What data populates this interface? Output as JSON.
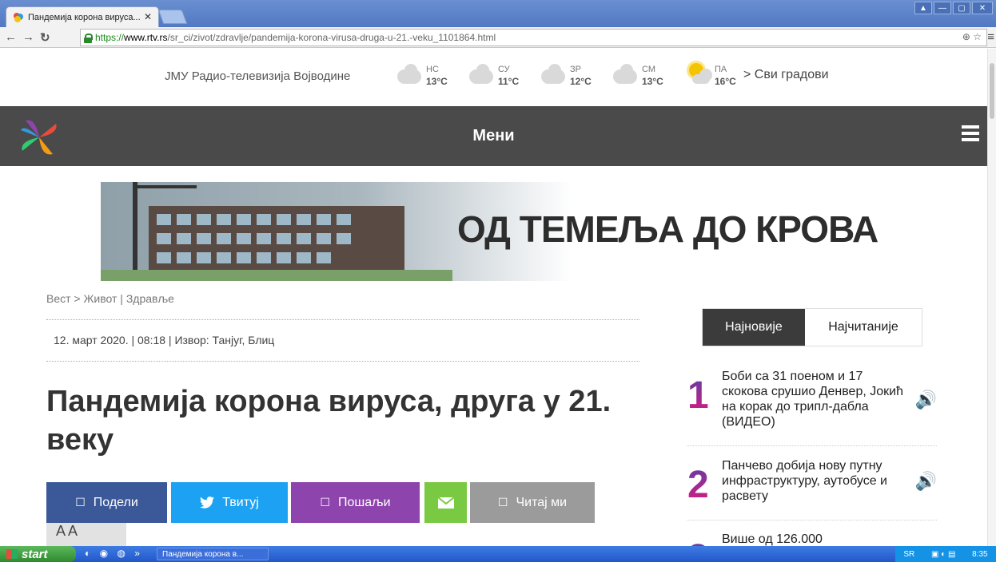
{
  "browser": {
    "tab_title": "Пандемија корона вируса...",
    "url_scheme": "https://",
    "url_host": "www.rtv.rs",
    "url_path": "/sr_ci/zivot/zdravlje/pandemija-korona-virusa-druga-u-21.-veku_1101864.html",
    "close_glyph": "✕"
  },
  "header": {
    "site_name": "ЈМУ Радио-телевизија Војводине",
    "weather": [
      {
        "city": "НС",
        "temp": "13°C",
        "icon": "cloud-icon"
      },
      {
        "city": "СУ",
        "temp": "11°C",
        "icon": "cloud-icon"
      },
      {
        "city": "ЗР",
        "temp": "12°C",
        "icon": "cloud-icon"
      },
      {
        "city": "СМ",
        "temp": "13°C",
        "icon": "cloud-icon"
      },
      {
        "city": "ПА",
        "temp": "16°C",
        "icon": "sun-cloud-icon"
      }
    ],
    "all_cities": "> Сви градови"
  },
  "menu": {
    "label": "Мени"
  },
  "banner": {
    "text": "ОД ТЕМЕЉА ДО КРОВА"
  },
  "article": {
    "breadcrumb": "Вест > Живот | Здравље",
    "meta": "12. март 2020. | 08:18 | Извор: Танјуг, Блиц",
    "title": "Пандемија корона вируса, друга у 21. веку",
    "share": {
      "podeli": "Подели",
      "tvituj": "Твитуј",
      "posalji": "Пошаљи",
      "citaj": "Читај ми"
    },
    "font_size_label": "A A"
  },
  "sidebar": {
    "tab_latest": "Најновије",
    "tab_most_read": "Најчитаније",
    "items": [
      {
        "num": "1",
        "headline": "Боби са 31 поеном и 17 скокова срушио Денвер, Јокић на корак до трипл-дабла (ВИДЕО)"
      },
      {
        "num": "2",
        "headline": "Панчево добија нову путну инфраструктуру, аутобусе и расвету"
      },
      {
        "num": "3",
        "headline": "Више од 126.000"
      }
    ]
  },
  "taskbar": {
    "start": "start",
    "task_item": "Пандемија корона в...",
    "tray_lang": "SR",
    "tray_time": "8:35"
  },
  "colors": {
    "facebook": "#3b5998",
    "twitter": "#1da1f2",
    "send": "#8e44ad",
    "email": "#7ac943",
    "read": "#9b9b9b",
    "menubar": "#4a4a4a"
  }
}
